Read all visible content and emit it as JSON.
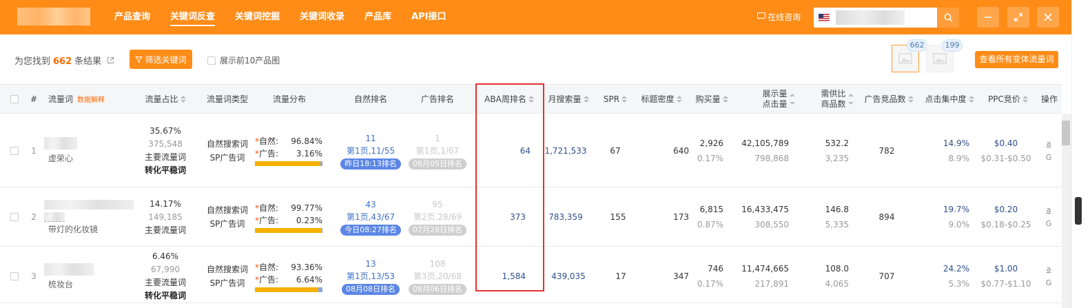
{
  "nav": {
    "items": [
      "产品查询",
      "关键词反查",
      "关键词挖掘",
      "关键词收录",
      "产品库",
      "API接口"
    ],
    "active_index": 1,
    "consult": "在线咨询"
  },
  "summary": {
    "prefix": "为您找到",
    "count": "662",
    "suffix": "条结果",
    "filter_btn": "筛选关键词",
    "show10": "展示前10产品图",
    "thumb_counts": [
      "662",
      "199"
    ],
    "variant_btn": "查看所有变体流量词"
  },
  "columns": {
    "index": "#",
    "keyword": "流量词",
    "keyword_tip": "数据解释",
    "share": "流量占比",
    "type": "流量词类型",
    "dist": "流量分布",
    "organic": "自然排名",
    "ad": "广告排名",
    "aba": "ABA周排名",
    "search": "月搜索量",
    "spr": "SPR",
    "density": "标题密度",
    "purchase": "购买量",
    "imp_1": "展示量",
    "imp_2": "点击量",
    "sd_1": "需供比",
    "sd_2": "商品数",
    "ad_count": "广告竞品数",
    "click_conc": "点击集中度",
    "ppc": "PPC竞价",
    "ops": "操作"
  },
  "rows": [
    {
      "idx": "1",
      "keyword": "虚荣心",
      "share_pct": "35.67%",
      "share_num": "375,548",
      "share_tag1": "主要流量词",
      "share_tag2": "转化平稳词",
      "type1": "自然搜索词",
      "type2": "SP广告词",
      "natural_label": "自然:",
      "natural_pct": "96.84%",
      "ad_label": "广告:",
      "ad_pct": "3.16%",
      "ad_share": 0.0316,
      "organic_rank": "11",
      "organic_page": "第1页,11/55",
      "organic_time": "昨日18:13排名",
      "ad_rank": "1",
      "ad_page": "第1页,1/67",
      "ad_time": "08月05日排名",
      "aba": "64",
      "search": "1,721,533",
      "spr": "67",
      "density": "640",
      "purchase": "2,926",
      "purchase_rate": "0.17%",
      "impressions": "42,105,789",
      "clicks": "798,868",
      "sd_ratio": "532.2",
      "products": "3,235",
      "ad_count": "782",
      "click_conc": "14.9%",
      "click_conc2": "8.9%",
      "ppc": "$0.40",
      "ppc_range": "$0.31-$0.50",
      "op_a": "a",
      "op_g": "G"
    },
    {
      "idx": "2",
      "keyword": "带灯的化妆镜",
      "share_pct": "14.17%",
      "share_num": "149,185",
      "share_tag1": "主要流量词",
      "share_tag2": "",
      "type1": "自然搜索词",
      "type2": "SP广告词",
      "natural_label": "自然:",
      "natural_pct": "99.77%",
      "ad_label": "广告:",
      "ad_pct": "0.23%",
      "ad_share": 0.0023,
      "organic_rank": "43",
      "organic_page": "第1页,43/67",
      "organic_time": "今日08:27排名",
      "ad_rank": "95",
      "ad_page": "第2页,28/69",
      "ad_time": "07月28日排名",
      "aba": "373",
      "search": "783,359",
      "spr": "155",
      "density": "173",
      "purchase": "6,815",
      "purchase_rate": "0.87%",
      "impressions": "16,433,475",
      "clicks": "308,550",
      "sd_ratio": "146.8",
      "products": "5,335",
      "ad_count": "894",
      "click_conc": "19.7%",
      "click_conc2": "9.0%",
      "ppc": "$0.20",
      "ppc_range": "$0.18-$0.25",
      "op_a": "a",
      "op_g": "G"
    },
    {
      "idx": "3",
      "keyword": "梳妆台",
      "share_pct": "6.46%",
      "share_num": "67,990",
      "share_tag1": "主要流量词",
      "share_tag2": "转化平稳词",
      "type1": "自然搜索词",
      "type2": "SP广告词",
      "natural_label": "自然:",
      "natural_pct": "93.36%",
      "ad_label": "广告:",
      "ad_pct": "6.64%",
      "ad_share": 0.0664,
      "organic_rank": "13",
      "organic_page": "第1页,13/53",
      "organic_time": "08月08日排名",
      "ad_rank": "108",
      "ad_page": "第3页,20/68",
      "ad_time": "08月06日排名",
      "aba": "1,584",
      "search": "439,035",
      "spr": "17",
      "density": "347",
      "purchase": "746",
      "purchase_rate": "0.17%",
      "impressions": "11,474,665",
      "clicks": "217,891",
      "sd_ratio": "108.0",
      "products": "4,065",
      "ad_count": "707",
      "click_conc": "24.2%",
      "click_conc2": "5.3%",
      "ppc": "$1.00",
      "ppc_range": "$0.77-$1.10",
      "op_a": "a",
      "op_g": "G"
    }
  ]
}
